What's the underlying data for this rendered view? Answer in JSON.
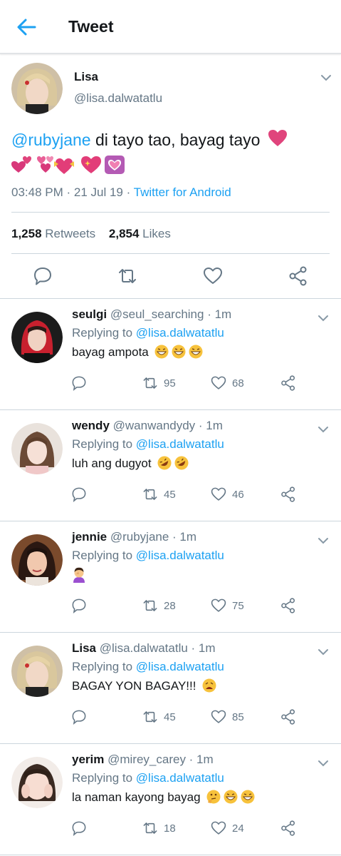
{
  "header": {
    "title": "Tweet"
  },
  "tweet": {
    "author_name": "Lisa",
    "author_handle": "@lisa.dalwatatlu",
    "mention": "@rubyjane",
    "text": " di tayo tao, bayag tayo",
    "time": "03:48 PM · 21 Jul 19 · ",
    "source": "Twitter for Android",
    "retweets_count": "1,258",
    "retweets_label": "Retweets",
    "likes_count": "2,854",
    "likes_label": "Likes"
  },
  "replying_label": "Replying to ",
  "replies": [
    {
      "name": "seulgi",
      "handle": "@seul_searching · 1m",
      "replying_to": "@lisa.dalwatatlu",
      "text": "bayag ampota",
      "retweets": "95",
      "likes": "68"
    },
    {
      "name": "wendy",
      "handle": "@wanwandydy · 1m",
      "replying_to": "@lisa.dalwatatlu",
      "text": "luh ang dugyot",
      "retweets": "45",
      "likes": "46"
    },
    {
      "name": "jennie",
      "handle": "@rubyjane · 1m",
      "replying_to": "@lisa.dalwatatlu",
      "text": "",
      "retweets": "28",
      "likes": "75"
    },
    {
      "name": "Lisa",
      "handle": "@lisa.dalwatatlu · 1m",
      "replying_to": "@lisa.dalwatatlu",
      "text": "BAGAY YON BAGAY!!!",
      "retweets": "45",
      "likes": "85"
    },
    {
      "name": "yerim",
      "handle": "@mirey_carey · 1m",
      "replying_to": "@lisa.dalwatatlu",
      "text": "la naman kayong bayag",
      "retweets": "18",
      "likes": "24"
    }
  ],
  "colors": {
    "link": "#1da1f2",
    "muted": "#657786",
    "divider": "#ccd6dd",
    "heart_emoji": "#e0447c"
  }
}
